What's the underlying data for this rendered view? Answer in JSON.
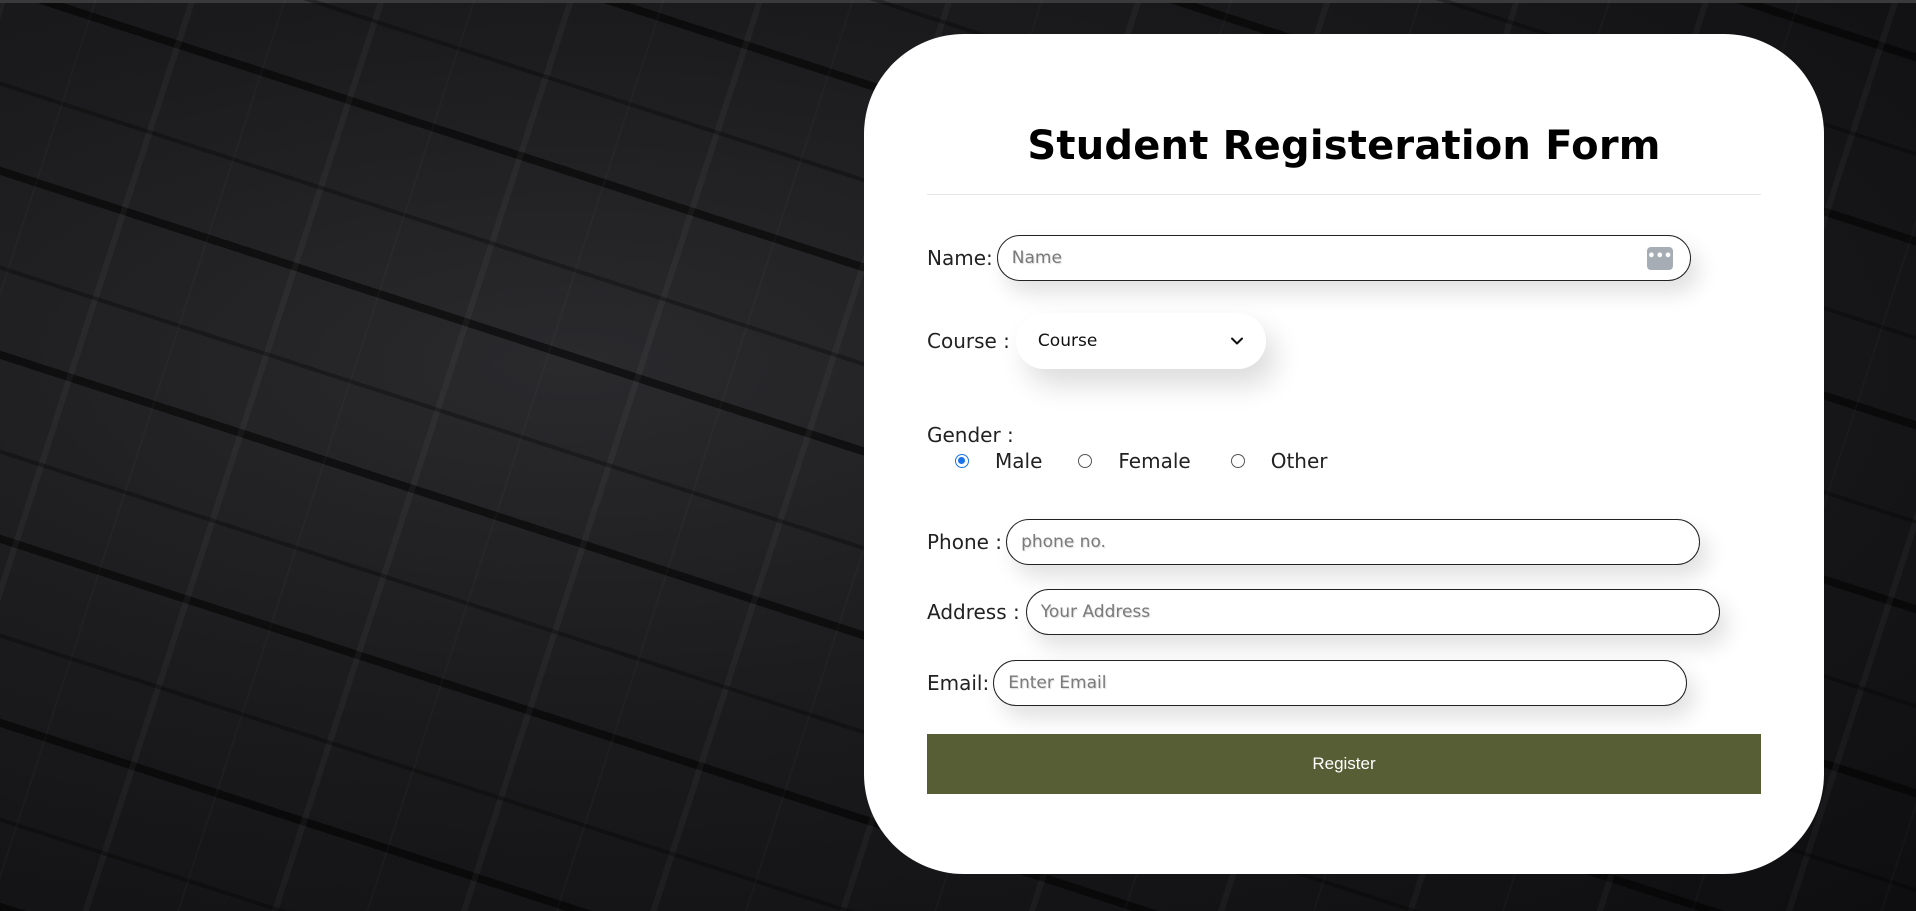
{
  "form": {
    "title": "Student Registeration Form",
    "name": {
      "label": "Name:",
      "placeholder": "Name",
      "value": ""
    },
    "course": {
      "label": "Course :",
      "selected": "Course"
    },
    "gender": {
      "label": "Gender :",
      "options": [
        {
          "label": "Male",
          "checked": true
        },
        {
          "label": "Female",
          "checked": false
        },
        {
          "label": "Other",
          "checked": false
        }
      ]
    },
    "phone": {
      "label": "Phone :",
      "placeholder": "phone no.",
      "value": ""
    },
    "address": {
      "label": "Address :",
      "placeholder": "Your Address",
      "value": ""
    },
    "email": {
      "label": "Email:",
      "placeholder": "Enter Email",
      "value": ""
    },
    "register_label": "Register"
  },
  "icons": {
    "autofill": "password-manager-icon",
    "dropdown": "chevron-down-icon"
  },
  "colors": {
    "register_button": "#575e36",
    "radio_checked": "#1a73e8",
    "card_background": "#ffffff",
    "page_background": "#141416"
  }
}
